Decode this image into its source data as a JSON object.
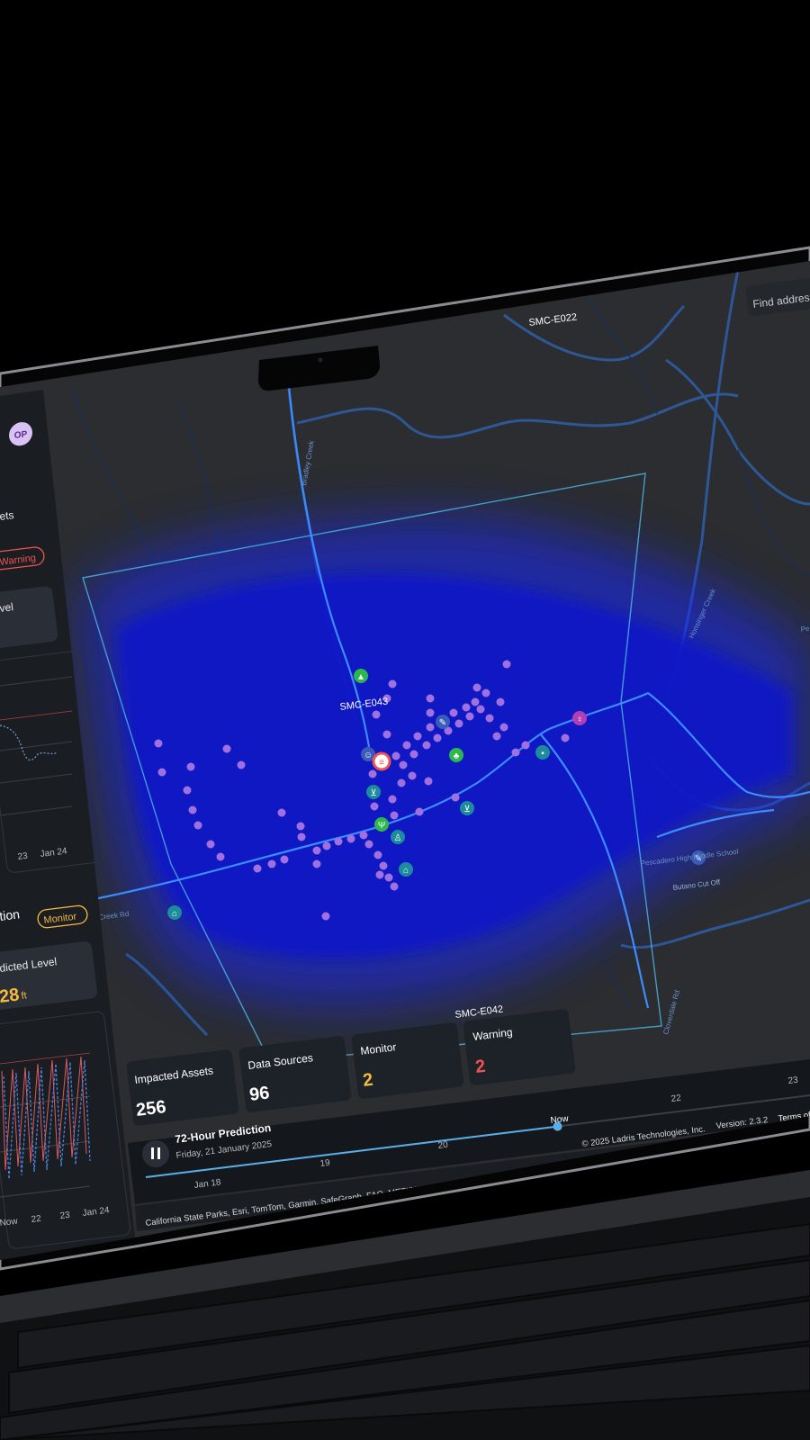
{
  "search": {
    "placeholder": "Find address"
  },
  "user": {
    "initials": "OP"
  },
  "sidebar": {
    "section1": {
      "title_partial": "ets",
      "status_badge": "Warning",
      "level_label_partial": "vel",
      "chart_ticks": [
        "23",
        "Jan 24"
      ]
    },
    "section2": {
      "title_partial": "tion",
      "status_badge": "Monitor",
      "level_label_partial": "dicted Level",
      "level_value": "28",
      "level_unit": "ft",
      "chart_ticks": [
        "Now",
        "22",
        "23",
        "Jan 24"
      ]
    }
  },
  "map": {
    "stations": [
      "SMC-E022",
      "SMC-E043",
      "SMC-E042"
    ],
    "roads": [
      "Bradley Creek",
      "Butano Cut Off",
      "Pescadero High Middle School",
      "Cloverdale Rd",
      "Creek Rd",
      "Honsinger Creek",
      "Pe"
    ]
  },
  "stats": [
    {
      "label": "Impacted Assets",
      "value": "256",
      "color": "#ffffff"
    },
    {
      "label": "Data Sources",
      "value": "96",
      "color": "#ffffff"
    },
    {
      "label": "Monitor",
      "value": "2",
      "color": "#f5b942"
    },
    {
      "label": "Warning",
      "value": "2",
      "color": "#ef5350"
    }
  ],
  "timeline": {
    "title": "72-Hour Prediction",
    "date": "Friday, 21 January 2025",
    "ticks": [
      "Jan 18",
      "19",
      "20",
      "Now",
      "22",
      "23"
    ],
    "progress": 0.62
  },
  "footer": {
    "attribution": "California State Parks, Esri, TomTom, Garmin, SafeGraph, FAO, METI/NASA, USGS, Bureau of Land Managemen...",
    "copyright": "© 2025 Ladris Technologies, Inc.",
    "version": "Version: 2.3.2",
    "terms": "Terms of"
  },
  "colors": {
    "flood": "#0a18d8",
    "asset": "#a070e0",
    "river": "#3a7ad6",
    "warning": "#ef5350",
    "monitor": "#f5b942",
    "panel": "#1d2229"
  }
}
